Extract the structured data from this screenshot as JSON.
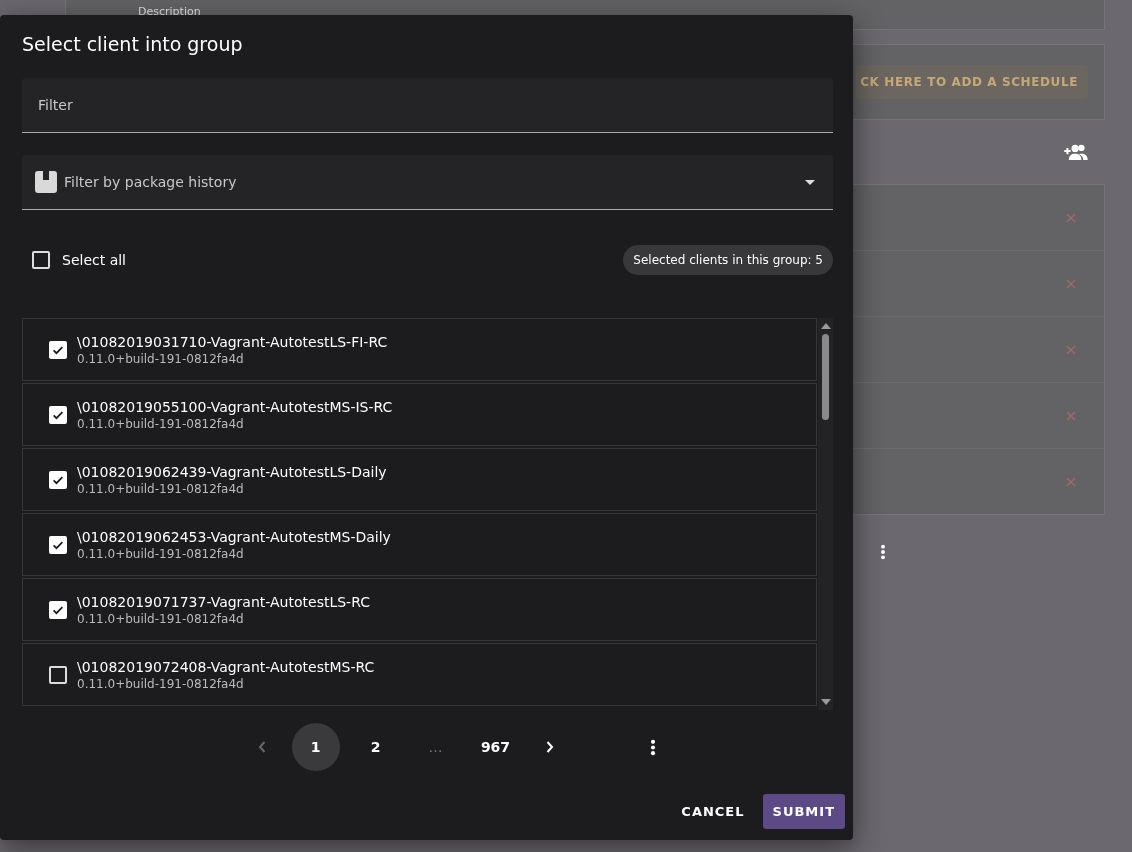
{
  "background": {
    "description_label": "Description",
    "schedule_button": "CK HERE TO ADD A SCHEDULE"
  },
  "dialog": {
    "title": "Select client into group",
    "filter": {
      "placeholder": "Filter"
    },
    "package_filter": {
      "placeholder": "Filter by package history"
    },
    "select_all": {
      "label": "Select all",
      "checked": false
    },
    "selected_count": "Selected clients in this group: 5",
    "clients": [
      {
        "name": "\\01082019031710-Vagrant-AutotestLS-FI-RC",
        "version": "0.11.0+build-191-0812fa4d",
        "checked": true
      },
      {
        "name": "\\01082019055100-Vagrant-AutotestMS-IS-RC",
        "version": "0.11.0+build-191-0812fa4d",
        "checked": true
      },
      {
        "name": "\\01082019062439-Vagrant-AutotestLS-Daily",
        "version": "0.11.0+build-191-0812fa4d",
        "checked": true
      },
      {
        "name": "\\01082019062453-Vagrant-AutotestMS-Daily",
        "version": "0.11.0+build-191-0812fa4d",
        "checked": true
      },
      {
        "name": "\\01082019071737-Vagrant-AutotestLS-RC",
        "version": "0.11.0+build-191-0812fa4d",
        "checked": true
      },
      {
        "name": "\\01082019072408-Vagrant-AutotestMS-RC",
        "version": "0.11.0+build-191-0812fa4d",
        "checked": false
      }
    ],
    "pagination": [
      {
        "label": "1",
        "kind": "page",
        "selected": true
      },
      {
        "label": "2",
        "kind": "page",
        "selected": false
      },
      {
        "label": "…",
        "kind": "ellipsis",
        "selected": false
      },
      {
        "label": "967",
        "kind": "page",
        "selected": false
      }
    ],
    "buttons": [
      {
        "label": "CANCEL",
        "kind": "text"
      },
      {
        "label": "SUBMIT",
        "kind": "primary"
      }
    ]
  }
}
